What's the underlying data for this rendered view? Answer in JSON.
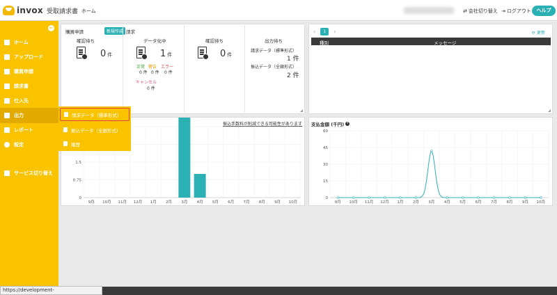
{
  "app": {
    "logo_text": "invox",
    "logo_sub": "受取請求書"
  },
  "header": {
    "nav_home": "ホーム",
    "switch_company": "会社切り替え",
    "logout": "ログアウト",
    "help": "ヘルプ"
  },
  "sidebar": {
    "items": [
      {
        "label": "ホーム",
        "icon": "home-icon"
      },
      {
        "label": "アップロード",
        "icon": "cloud-upload-icon"
      },
      {
        "label": "購買申請",
        "icon": "document-icon"
      },
      {
        "label": "請求書",
        "icon": "invoice-icon"
      },
      {
        "label": "仕入先",
        "icon": "building-icon"
      },
      {
        "label": "出力",
        "icon": "export-icon"
      },
      {
        "label": "レポート",
        "icon": "chart-icon"
      },
      {
        "label": "設定",
        "icon": "gear-icon"
      },
      {
        "label": "サービス切り替え",
        "icon": "swap-icon"
      }
    ]
  },
  "flyout": {
    "items": [
      {
        "label": "請求データ（標準形式）"
      },
      {
        "label": "振込データ（全銀形式）"
      },
      {
        "label": "履歴"
      }
    ]
  },
  "summary": {
    "purchase_title": "購買申請",
    "new_badge": "新規作成",
    "invoice_title": "請求",
    "pending_approval_1": {
      "label": "確認待ち",
      "count": "0",
      "unit": "件"
    },
    "data_entry": {
      "label": "データ化中",
      "count": "1",
      "unit": "件"
    },
    "pending_approval_2": {
      "label": "確認待ち",
      "count": "0",
      "unit": "件"
    },
    "breakdown": {
      "normal_label": "正常",
      "normal_value": "0 件",
      "warning_label": "警告",
      "warning_value": "0 件",
      "error_label": "エラー",
      "error_value": "0 件",
      "cancel_label": "キャンセル",
      "cancel_value": "0 件"
    },
    "output_pending": {
      "label": "出力待ち",
      "invoice_data_label": "請求データ（標準形式）",
      "invoice_data_value": "1 件",
      "transfer_data_label": "振込データ（全銀形式）",
      "transfer_data_value": "2 件"
    }
  },
  "messages": {
    "prev": "‹",
    "page": "1",
    "next": "›",
    "refresh": "更新",
    "col_type": "種別",
    "col_message": "メッセージ"
  },
  "left_chart_note": "振込手数料が削減できる可能性があります",
  "right_chart_title": "支払金額 (千円)",
  "colors": {
    "accent": "#2bb0b3",
    "sidebar": "#f9c300",
    "highlight_border": "#e0433f"
  },
  "status_url": "https://development-web.invox.jp/home#",
  "chart_data": [
    {
      "type": "bar",
      "title": "",
      "categories": [
        "9月",
        "10月",
        "11月",
        "12月",
        "1月",
        "2月",
        "3月",
        "4月",
        "5月",
        "6月",
        "7月",
        "8月",
        "9月",
        "10月"
      ],
      "values": [
        0,
        0,
        0,
        0,
        0,
        0,
        3.4,
        1,
        0,
        0,
        0,
        0,
        0,
        0
      ],
      "yticks": [
        "0",
        "0.75",
        "1.5"
      ],
      "ylim": [
        0,
        3
      ],
      "grid": true
    },
    {
      "type": "line",
      "title": "支払金額 (千円)",
      "categories": [
        "9月",
        "10月",
        "11月",
        "12月",
        "1月",
        "2月",
        "3月",
        "4月",
        "5月",
        "6月",
        "7月",
        "8月",
        "9月",
        "10月"
      ],
      "values": [
        0,
        0,
        0,
        0,
        0,
        0,
        42,
        0,
        0,
        0,
        0,
        0,
        0,
        0
      ],
      "yticks": [
        "0",
        "15",
        "30",
        "45",
        "60"
      ],
      "ylim": [
        0,
        60
      ],
      "grid": true
    }
  ]
}
